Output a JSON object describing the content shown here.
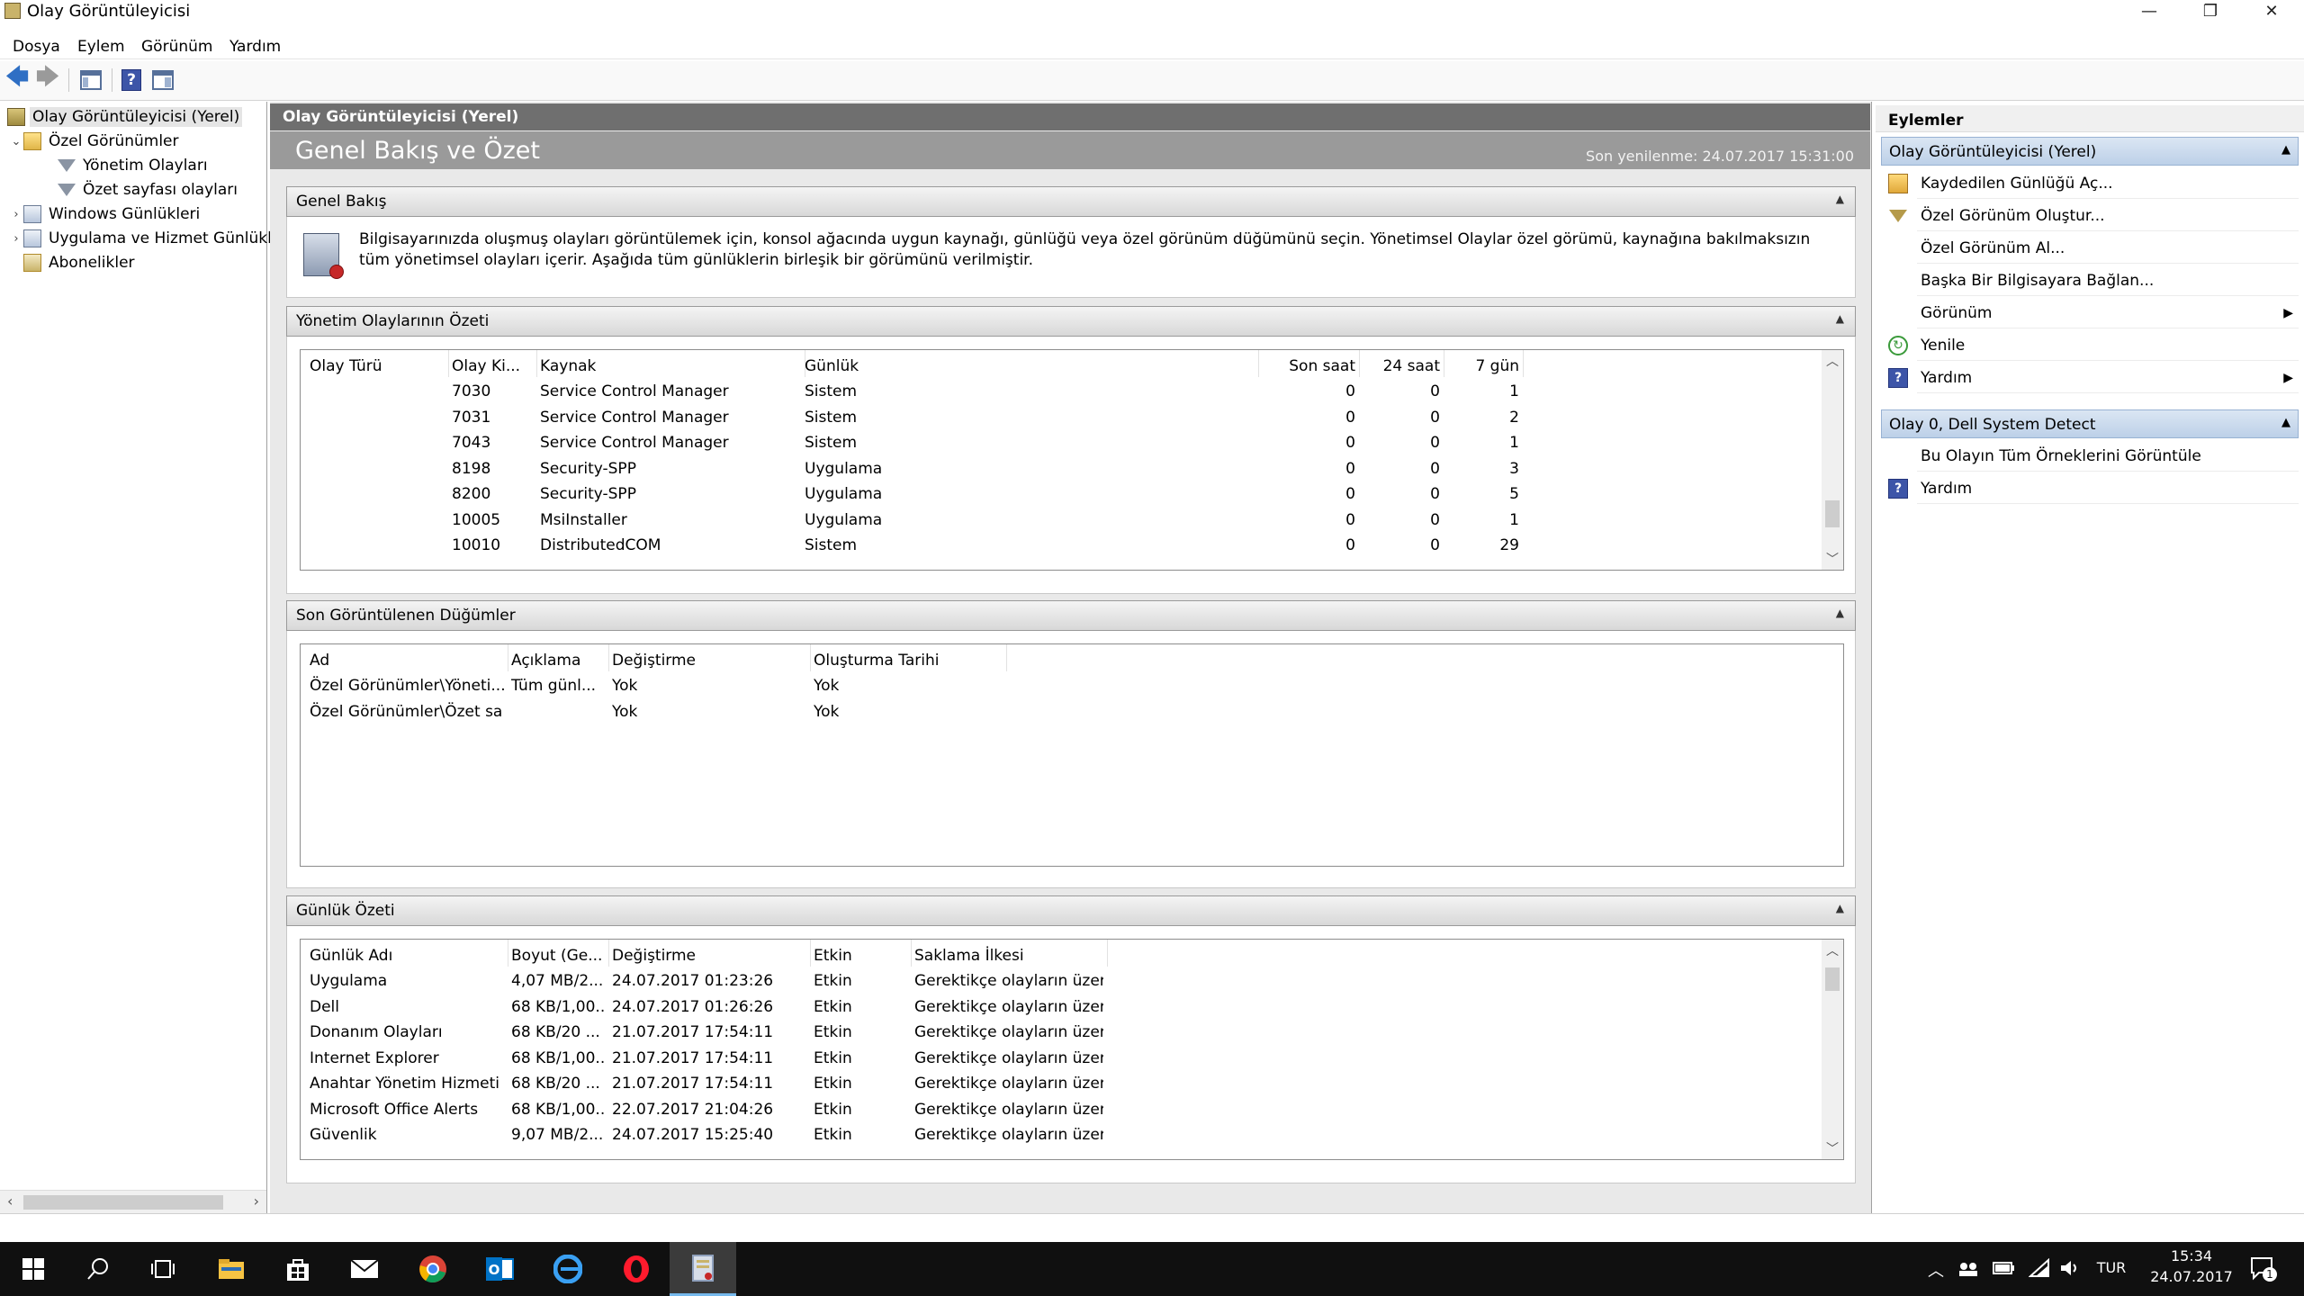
{
  "window": {
    "title": "Olay Görüntüleyicisi",
    "minimize_glyph": "—",
    "maximize_glyph": "❐",
    "close_glyph": "✕"
  },
  "menu": [
    "Dosya",
    "Eylem",
    "Görünüm",
    "Yardım"
  ],
  "toolbar": {
    "icons": [
      "back-arrow-icon",
      "forward-arrow-icon",
      "show-hide-console-tree-icon",
      "help-icon",
      "show-hide-action-pane-icon"
    ],
    "back_glyph": "🡄",
    "forward_glyph": "🡆",
    "help_glyph": "?"
  },
  "tree": {
    "items": [
      {
        "label": "Olay Görüntüleyicisi (Yerel)",
        "icon": "event-viewer-icon",
        "selected": true
      },
      {
        "label": "Özel Görünümler",
        "icon": "folder-icon",
        "toggle": "⌄"
      },
      {
        "label": "Yönetim Olayları",
        "icon": "filter-icon"
      },
      {
        "label": "Özet sayfası olayları",
        "icon": "filter-icon"
      },
      {
        "label": "Windows Günlükleri",
        "icon": "log-folder-icon",
        "toggle": "›"
      },
      {
        "label": "Uygulama ve Hizmet Günlükl",
        "icon": "log-folder-icon",
        "toggle": "›"
      },
      {
        "label": "Abonelikler",
        "icon": "subscriptions-icon"
      }
    ],
    "scroll_left_glyph": "‹",
    "scroll_right_glyph": "›"
  },
  "center": {
    "header": "Olay Görüntüleyicisi (Yerel)",
    "banner_title": "Genel Bakış ve Özet",
    "last_refresh": "Son yenilenme: 24.07.2017 15:31:00",
    "collapse_glyph": "▲",
    "overview": {
      "title": "Genel Bakış",
      "text": "Bilgisayarınızda oluşmuş olayları görüntülemek için, konsol ağacında uygun kaynağı, günlüğü veya özel görünüm düğümünü seçin. Yönetimsel Olaylar özel görümü, kaynağına bakılmaksızın tüm yönetimsel olayları içerir. Aşağıda tüm günlüklerin birleşik bir görümünü verilmiştir."
    },
    "admin_summary": {
      "title": "Yönetim Olaylarının Özeti",
      "columns": [
        "Olay Türü",
        "Olay Ki...",
        "Kaynak",
        "Günlük",
        "Son saat",
        "24 saat",
        "7 gün"
      ],
      "rows": [
        [
          "",
          "7030",
          "Service Control Manager",
          "Sistem",
          "0",
          "0",
          "1"
        ],
        [
          "",
          "7031",
          "Service Control Manager",
          "Sistem",
          "0",
          "0",
          "2"
        ],
        [
          "",
          "7043",
          "Service Control Manager",
          "Sistem",
          "0",
          "0",
          "1"
        ],
        [
          "",
          "8198",
          "Security-SPP",
          "Uygulama",
          "0",
          "0",
          "3"
        ],
        [
          "",
          "8200",
          "Security-SPP",
          "Uygulama",
          "0",
          "0",
          "5"
        ],
        [
          "",
          "10005",
          "MsiInstaller",
          "Uygulama",
          "0",
          "0",
          "1"
        ],
        [
          "",
          "10010",
          "DistributedCOM",
          "Sistem",
          "0",
          "0",
          "29"
        ]
      ],
      "scroll_position": 0.85
    },
    "recent_nodes": {
      "title": "Son Görüntülenen Düğümler",
      "columns": [
        "Ad",
        "Açıklama",
        "Değiştirme",
        "Oluşturma Tarihi"
      ],
      "rows": [
        [
          "Özel Görünümler\\Yöneti...",
          "Tüm günl...",
          "Yok",
          "Yok"
        ],
        [
          "Özel Görünümler\\Özet sa...",
          "",
          "Yok",
          "Yok"
        ]
      ]
    },
    "log_summary": {
      "title": "Günlük Özeti",
      "columns": [
        "Günlük Adı",
        "Boyut (Ge...",
        "Değiştirme",
        "Etkin",
        "Saklama İlkesi"
      ],
      "rows": [
        [
          "Uygulama",
          "4,07 MB/2...",
          "24.07.2017 01:23:26",
          "Etkin",
          "Gerektikçe olayların üzeri..."
        ],
        [
          "Dell",
          "68 KB/1,00...",
          "24.07.2017 01:26:26",
          "Etkin",
          "Gerektikçe olayların üzeri..."
        ],
        [
          "Donanım Olayları",
          "68 KB/20 ...",
          "21.07.2017 17:54:11",
          "Etkin",
          "Gerektikçe olayların üzeri..."
        ],
        [
          "Internet Explorer",
          "68 KB/1,00...",
          "21.07.2017 17:54:11",
          "Etkin",
          "Gerektikçe olayların üzeri..."
        ],
        [
          "Anahtar Yönetim Hizmeti",
          "68 KB/20 ...",
          "21.07.2017 17:54:11",
          "Etkin",
          "Gerektikçe olayların üzeri..."
        ],
        [
          "Microsoft Office Alerts",
          "68 KB/1,00...",
          "22.07.2017 21:04:26",
          "Etkin",
          "Gerektikçe olayların üzeri..."
        ],
        [
          "Güvenlik",
          "9,07 MB/2...",
          "24.07.2017 15:25:40",
          "Etkin",
          "Gerektikçe olayların üzeri..."
        ]
      ],
      "scroll_position": 0.05
    },
    "scroll_up_glyph": "︿",
    "scroll_down_glyph": "﹀"
  },
  "actions": {
    "title": "Eylemler",
    "group1": {
      "label": "Olay Görüntüleyicisi (Yerel)",
      "items": [
        {
          "label": "Kaydedilen Günlüğü Aç...",
          "icon": "open-folder-icon"
        },
        {
          "label": "Özel Görünüm Oluştur...",
          "icon": "filter-icon"
        },
        {
          "label": "Özel Görünüm Al...",
          "icon": ""
        },
        {
          "label": "Başka Bir Bilgisayara Bağlan...",
          "icon": ""
        },
        {
          "label": "Görünüm",
          "icon": "",
          "submenu": true
        },
        {
          "label": "Yenile",
          "icon": "refresh-icon"
        },
        {
          "label": "Yardım",
          "icon": "help-icon",
          "submenu": true
        }
      ]
    },
    "group2": {
      "label": "Olay 0, Dell System Detect",
      "items": [
        {
          "label": "Bu Olayın Tüm Örneklerini Görüntüle",
          "icon": ""
        },
        {
          "label": "Yardım",
          "icon": "help-icon"
        }
      ]
    },
    "collapse_glyph": "▲",
    "submenu_glyph": "▶",
    "help_glyph": "?",
    "refresh_glyph": "↻"
  },
  "taskbar": {
    "apps": [
      "start-icon",
      "search-icon",
      "task-view-icon",
      "file-explorer-icon",
      "store-icon",
      "mail-icon",
      "chrome-icon",
      "outlook-icon",
      "edge-icon",
      "opera-icon",
      "event-viewer-icon"
    ],
    "tray": {
      "language": "TUR",
      "time": "15:34",
      "date": "24.07.2017",
      "notification_count": "1",
      "up_glyph": "︿"
    }
  },
  "colors": {
    "center_header_bg": "#6f6f6f",
    "center_banner_bg": "#9a9a9a",
    "action_group_bg": "#bcd0e8",
    "taskbar_bg": "#101010",
    "active_app_underline": "#76b9ed"
  }
}
